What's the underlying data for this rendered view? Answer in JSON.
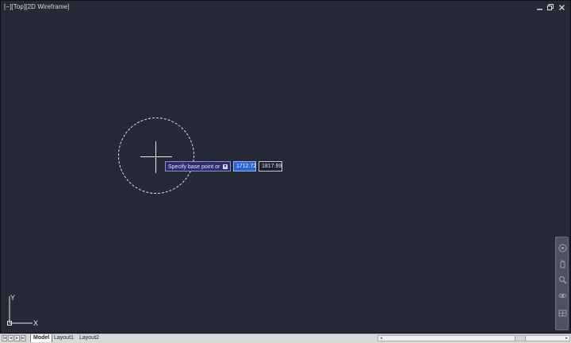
{
  "viewport": {
    "controls_minus": "[−]",
    "view_top": "[Top]",
    "visual_style": "[2D Wireframe]",
    "background_color": "#252935"
  },
  "command": {
    "prompt": "Specify base point or",
    "x_value": "1712.72",
    "y_value": "1817.99"
  },
  "ucs": {
    "y_label": "Y",
    "x_label": "X"
  },
  "tabs": [
    "Model",
    "Layout1",
    "Layout2"
  ],
  "icons": {
    "window_controls": [
      "minimize-icon",
      "restore-icon",
      "close-icon"
    ],
    "navigation_bar": [
      "steering-wheel-icon",
      "pan-icon",
      "zoom-icon",
      "orbit-icon",
      "showmotion-icon"
    ],
    "tab_navigation": [
      "first-tab-icon",
      "previous-tab-icon",
      "next-tab-icon",
      "last-tab-icon"
    ]
  }
}
